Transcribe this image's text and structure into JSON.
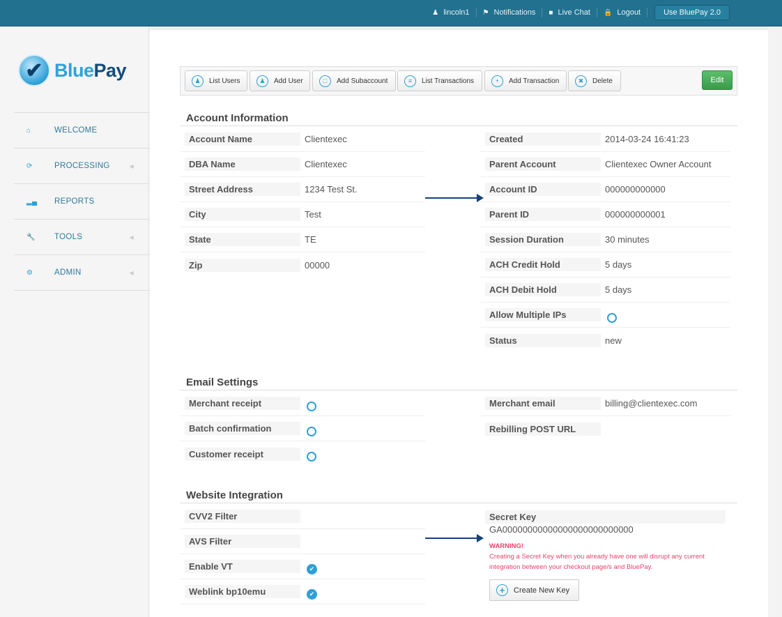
{
  "topbar": {
    "user": "lincoln1",
    "notifications": "Notifications",
    "live_chat": "Live Chat",
    "logout": "Logout",
    "use_button": "Use BluePay 2.0"
  },
  "brand": {
    "name_a": "Blue",
    "name_b": "Pay"
  },
  "sidebar": {
    "items": [
      {
        "label": "WELCOME",
        "icon": "home-icon"
      },
      {
        "label": "PROCESSING",
        "icon": "refresh-icon"
      },
      {
        "label": "REPORTS",
        "icon": "signal-icon"
      },
      {
        "label": "TOOLS",
        "icon": "wrench-icon"
      },
      {
        "label": "ADMIN",
        "icon": "gear-icon"
      }
    ]
  },
  "toolbar": {
    "list_users": "List Users",
    "add_user": "Add User",
    "add_subaccount": "Add Subaccount",
    "list_transactions": "List Transactions",
    "add_transaction": "Add Transaction",
    "delete": "Delete",
    "edit": "Edit"
  },
  "account": {
    "title": "Account Information",
    "left": [
      {
        "label": "Account Name",
        "value": "Clientexec"
      },
      {
        "label": "DBA Name",
        "value": "Clientexec"
      },
      {
        "label": "Street Address",
        "value": "1234 Test St."
      },
      {
        "label": "City",
        "value": "Test"
      },
      {
        "label": "State",
        "value": "TE"
      },
      {
        "label": "Zip",
        "value": "00000"
      }
    ],
    "right": [
      {
        "label": "Created",
        "value": "2014-03-24 16:41:23"
      },
      {
        "label": "Parent Account",
        "value": "Clientexec Owner Account"
      },
      {
        "label": "Account ID",
        "value": "000000000000"
      },
      {
        "label": "Parent ID",
        "value": "000000000001"
      },
      {
        "label": "Session Duration",
        "value": "30 minutes"
      },
      {
        "label": "ACH Credit Hold",
        "value": "5 days"
      },
      {
        "label": "ACH Debit Hold",
        "value": "5 days"
      },
      {
        "label": "Allow Multiple IPs",
        "value": ""
      },
      {
        "label": "Status",
        "value": "new"
      }
    ]
  },
  "email": {
    "title": "Email Settings",
    "merchant_receipt": "Merchant receipt",
    "batch_confirmation": "Batch confirmation",
    "customer_receipt": "Customer receipt",
    "merchant_email_label": "Merchant email",
    "merchant_email": "billing@clientexec.com",
    "rebilling_label": "Rebilling POST URL"
  },
  "web": {
    "title": "Website Integration",
    "cvv2": "CVV2 Filter",
    "avs": "AVS Filter",
    "enable_vt": "Enable VT",
    "weblink": "Weblink bp10emu",
    "secret_key_label": "Secret Key",
    "secret_key": "GA00000000000000000000000000",
    "warning_title": "WARNING!",
    "warning_text": "Creating a Secret Key when you already have one will disrupt any current integration between your checkout page/s and BluePay.",
    "create_key": "Create New Key"
  },
  "colors": {
    "topbar": "#21718f",
    "accent": "#2ea0d5",
    "warning": "#e8436b",
    "edit": "#3a9a4b"
  }
}
